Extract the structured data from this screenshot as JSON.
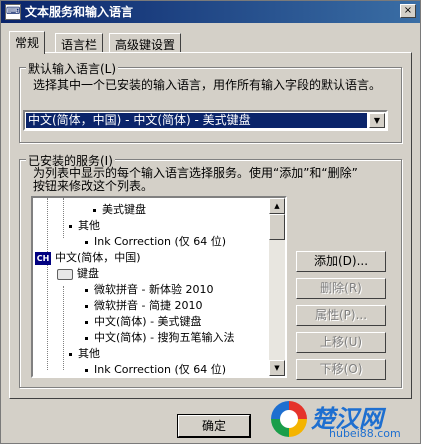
{
  "window": {
    "title": "文本服务和输入语言",
    "close_glyph": "×"
  },
  "tabs": [
    {
      "label": "常规",
      "active": true
    },
    {
      "label": "语言栏",
      "active": false
    },
    {
      "label": "高级键设置",
      "active": false
    }
  ],
  "default_language": {
    "label": "默认输入语言(L)",
    "description": "选择其中一个已安装的输入语言，用作所有输入字段的默认语言。",
    "selected": "中文(简体，中国) - 中文(简体) - 美式键盘"
  },
  "installed_services": {
    "label": "已安装的服务(I)",
    "description_line1": "为列表中显示的每个输入语言选择服务。使用“添加”和“删除”",
    "description_line2": "按钮来修改这个列表。",
    "tree": {
      "row1": "美式键盘",
      "row2": "其他",
      "row3": "Ink Correction (仅 64 位)",
      "lang_badge": "CH",
      "row4": "中文(简体，中国)",
      "row5": "键盘",
      "row6": "微软拼音 - 新体验 2010",
      "row7": "微软拼音 - 简捷 2010",
      "row8": "中文(简体) - 美式键盘",
      "row9": "中文(简体) - 搜狗五笔输入法",
      "row10": "其他",
      "row11": "Ink Correction (仅 64 位)"
    }
  },
  "buttons": {
    "add": "添加(D)...",
    "remove": "删除(R)",
    "properties": "属性(P)...",
    "move_up": "上移(U)",
    "move_down": "下移(O)",
    "ok": "确定"
  },
  "watermark": {
    "name": "楚汉网",
    "url": "hubei88.com"
  }
}
